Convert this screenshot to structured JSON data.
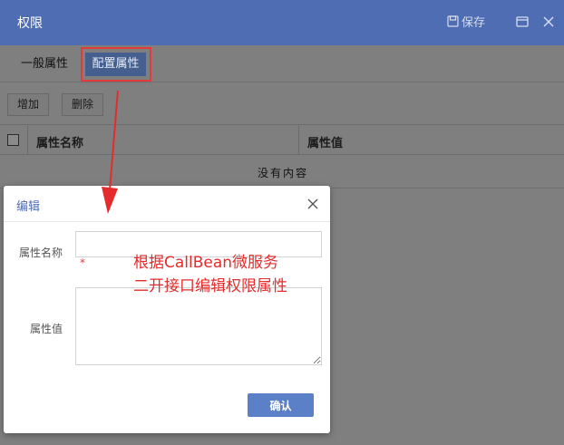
{
  "window": {
    "title": "权限",
    "save_label": "保存",
    "icons": [
      "save-icon",
      "maximize-icon",
      "close-icon"
    ]
  },
  "tabs": [
    {
      "label": "一般属性",
      "active": false
    },
    {
      "label": "配置属性",
      "active": true
    }
  ],
  "toolbar": {
    "add_label": "增加",
    "delete_label": "删除"
  },
  "grid": {
    "columns": [
      "属性名称",
      "属性值"
    ],
    "empty_message": "没有内容"
  },
  "dialog": {
    "title": "编辑",
    "name_label": "属性名称",
    "name_value": "",
    "required_mark": "*",
    "value_label": "属性值",
    "value_value": "",
    "confirm_label": "确认"
  },
  "annotation": {
    "line1": "根据CallBean微服务",
    "line2": "二开接口编辑权限属性",
    "color": "#e52b2b"
  },
  "colors": {
    "titlebar": "#4f6db3",
    "active_tab": "#45608f",
    "confirm_button": "#5b80c8",
    "highlight": "#e23b3b"
  }
}
